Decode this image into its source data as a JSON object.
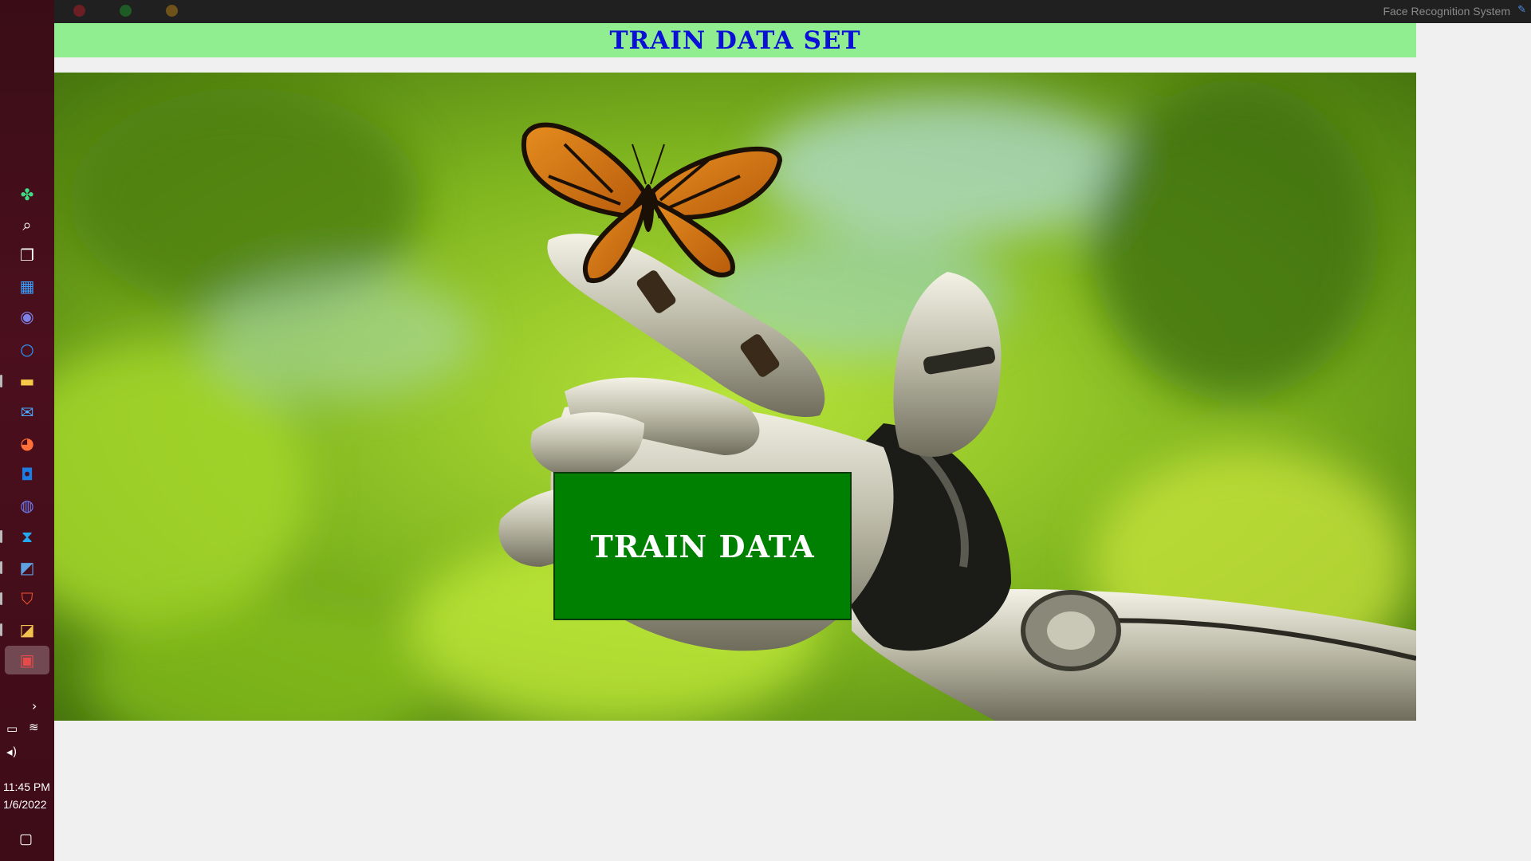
{
  "window": {
    "title": "Face Recognition System",
    "controls": [
      "close-dot",
      "minimize-dot",
      "maximize-dot"
    ]
  },
  "header": {
    "title": "TRAIN DATA SET",
    "background_color": "#90ee90",
    "text_color": "#0a10d6"
  },
  "main": {
    "train_button_label": "TRAIN DATA",
    "train_button_color": "#008000"
  },
  "taskbar": {
    "icons": [
      "widgets-icon",
      "search-icon",
      "task-view-icon",
      "store-icon",
      "teams-icon",
      "cortana-icon",
      "file-explorer-icon",
      "mail-icon",
      "firefox-icon",
      "app-icon",
      "discord-icon",
      "vscode-icon",
      "remote-icon",
      "brave-icon",
      "python-icon",
      "face-recognition-app-icon"
    ],
    "tray": {
      "chevron": "chevron-right-icon",
      "battery": "battery-icon",
      "wifi": "wifi-icon",
      "volume": "volume-icon",
      "notification": "notification-icon"
    },
    "time": "11:45 PM",
    "date": "1/6/2022"
  }
}
